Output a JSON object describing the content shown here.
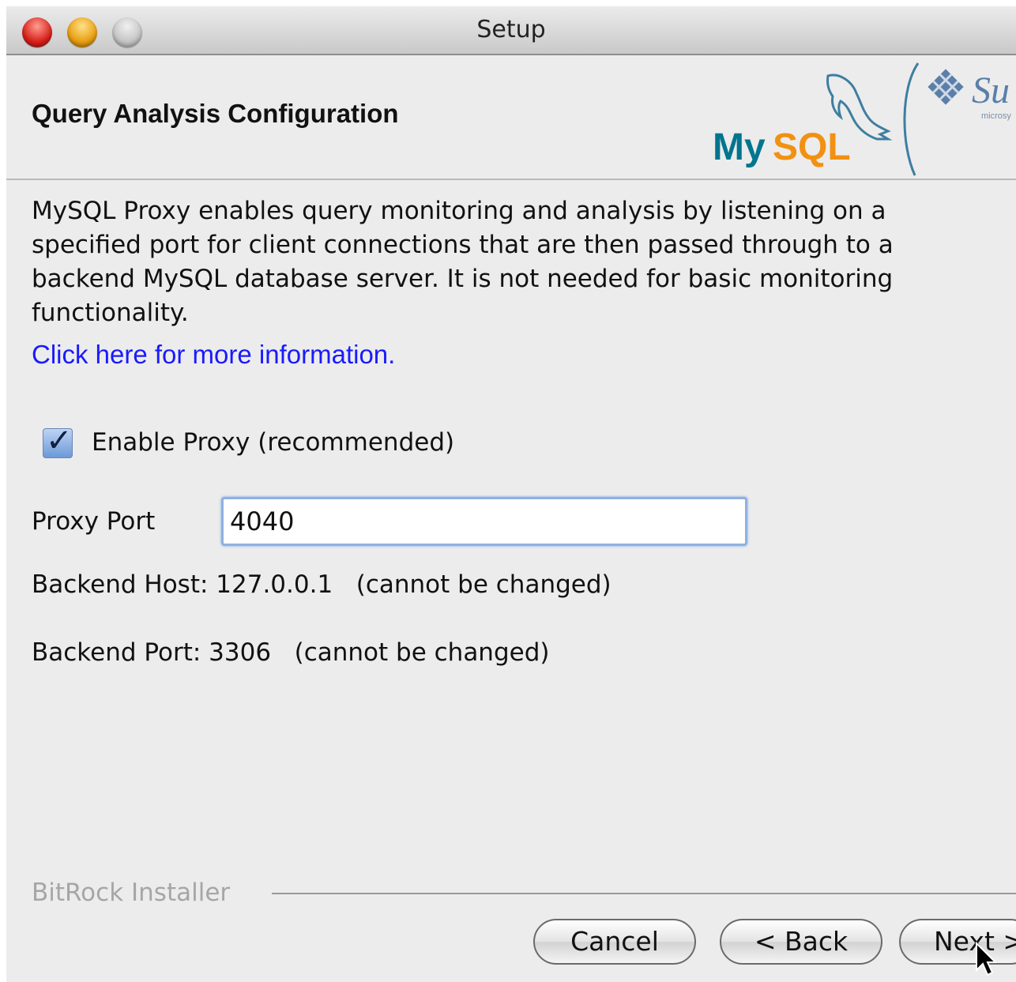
{
  "window": {
    "title": "Setup"
  },
  "header": {
    "page_title": "Query Analysis Configuration",
    "logo_text": "MySQL",
    "partner_logo_text": "Su",
    "partner_logo_subtext": "microsy"
  },
  "content": {
    "description": "MySQL Proxy enables query monitoring and analysis by listening on a specified port for client connections that are then passed through to a backend MySQL database server. It is not needed for basic monitoring functionality.",
    "info_link": "Click here for more information.",
    "enable_proxy_label": "Enable Proxy (recommended)",
    "enable_proxy_checked": true,
    "proxy_port_label": "Proxy Port",
    "proxy_port_value": "4040",
    "backend_host_text": "Backend Host: 127.0.0.1   (cannot be changed)",
    "backend_port_text": "Backend Port: 3306   (cannot be changed)"
  },
  "footer": {
    "installer_label": "BitRock Installer",
    "cancel_label": "Cancel",
    "back_label": "< Back",
    "next_label": "Next >"
  },
  "colors": {
    "link": "#1a1aff",
    "mysql_blue": "#00758f",
    "mysql_orange": "#f29111",
    "focus_ring": "#8fb1e0"
  }
}
